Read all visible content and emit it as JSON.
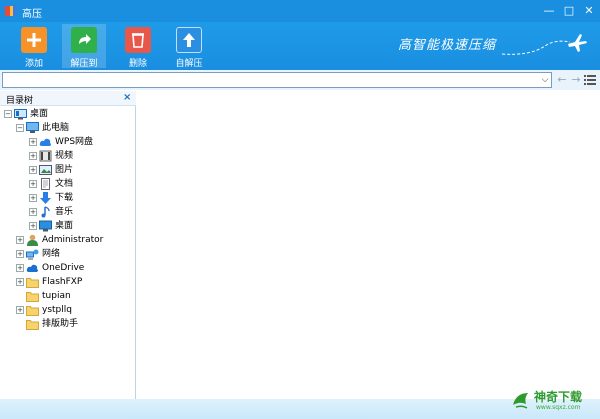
{
  "window": {
    "title": "高压",
    "minimize": "—",
    "maximize": "□",
    "close": "✕"
  },
  "toolbar": {
    "items": [
      {
        "label": "添加",
        "color": "#f5922a"
      },
      {
        "label": "解压到",
        "color": "#2fb04a"
      },
      {
        "label": "删除",
        "color": "#e8584a"
      },
      {
        "label": "自解压",
        "color": "#2a8fe0"
      }
    ],
    "slogan": "高智能极速压缩"
  },
  "address": {
    "value": "",
    "dropdown": "⌵",
    "back": "←",
    "forward": "→"
  },
  "tree": {
    "title": "目录树",
    "close": "×",
    "items": [
      {
        "label": "桌面",
        "icon": "desktop-icon"
      },
      {
        "label": "此电脑",
        "icon": "computer-icon"
      },
      {
        "label": "WPS网盘",
        "icon": "cloud-icon"
      },
      {
        "label": "视频",
        "icon": "video-icon"
      },
      {
        "label": "图片",
        "icon": "picture-icon"
      },
      {
        "label": "文档",
        "icon": "document-icon"
      },
      {
        "label": "下载",
        "icon": "download-icon"
      },
      {
        "label": "音乐",
        "icon": "music-icon"
      },
      {
        "label": "桌面",
        "icon": "desktop-icon"
      },
      {
        "label": "Administrator",
        "icon": "user-icon"
      },
      {
        "label": "网络",
        "icon": "network-icon"
      },
      {
        "label": "OneDrive",
        "icon": "cloud-icon"
      },
      {
        "label": "FlashFXP",
        "icon": "folder-icon"
      },
      {
        "label": "tupian",
        "icon": "folder-icon"
      },
      {
        "label": "ystpllq",
        "icon": "folder-icon"
      },
      {
        "label": "排版助手",
        "icon": "folder-icon"
      }
    ]
  },
  "watermark": {
    "text": "神奇下载",
    "sub": "www.sqxz.com"
  },
  "colors": {
    "titlebar": "#1a8fe0",
    "toolbar": "#1e9be8",
    "folder": "#f6d36b",
    "brand_green": "#2e9a2e"
  }
}
